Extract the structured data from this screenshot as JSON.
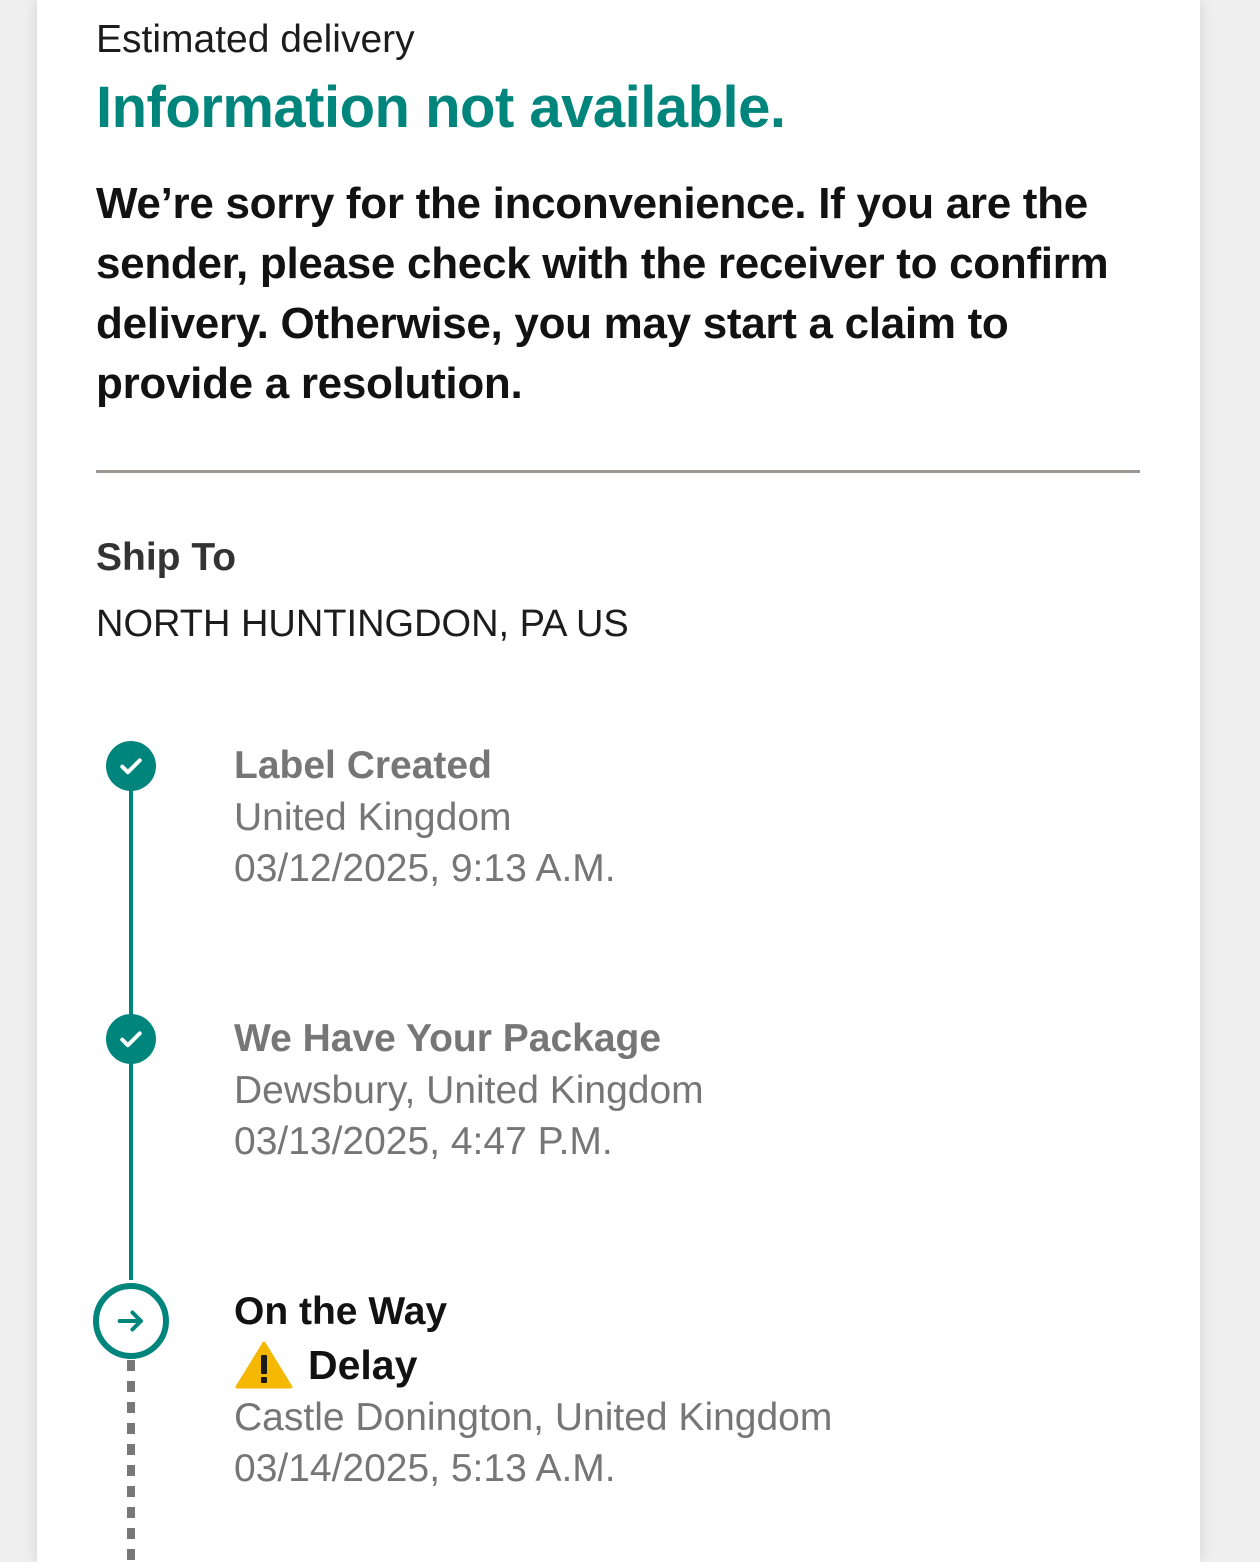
{
  "delivery": {
    "label": "Estimated delivery",
    "value": "Information not available.",
    "message": "We’re sorry for the inconvenience. If you are the sender, please check with the receiver to confirm delivery. Otherwise, you may start a claim to provide a resolution."
  },
  "ship_to": {
    "heading": "Ship To",
    "address": "NORTH HUNTINGDON, PA US"
  },
  "timeline": [
    {
      "title": "Label Created",
      "location": "United Kingdom",
      "datetime": "03/12/2025, 9:13 A.M.",
      "state": "complete"
    },
    {
      "title": "We Have Your Package",
      "location": "Dewsbury, United Kingdom",
      "datetime": "03/13/2025, 4:47 P.M.",
      "state": "complete"
    },
    {
      "title": "On the Way",
      "status": "Delay",
      "location": "Castle Donington, United Kingdom",
      "datetime": "03/14/2025, 5:13 A.M.",
      "state": "current"
    }
  ],
  "icons": {
    "complete": "check-icon",
    "current": "arrow-right-icon",
    "status": "warning-icon"
  },
  "colors": {
    "accent": "#00857d",
    "warning": "#f5b800",
    "muted_text": "#767676"
  }
}
